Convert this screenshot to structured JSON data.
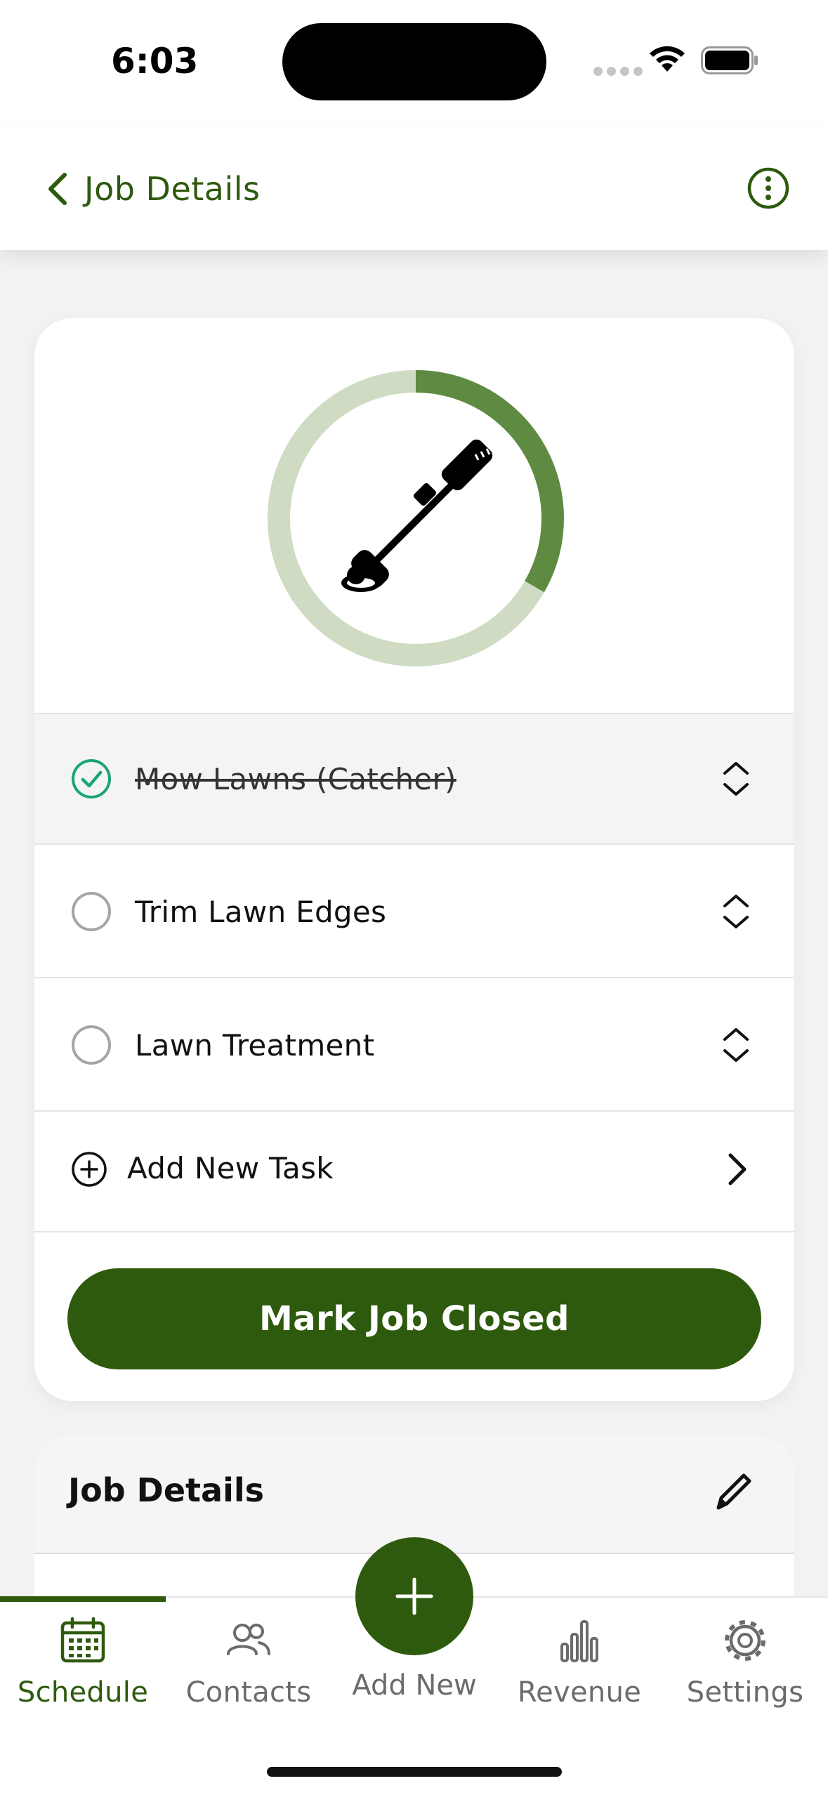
{
  "status_bar": {
    "time": "6:03"
  },
  "header": {
    "title": "Job Details",
    "back_icon": "chevron-left-icon",
    "menu_icon": "more-vertical-icon"
  },
  "job": {
    "progress_fraction": 0.333,
    "icon": "string-trimmer-icon",
    "tasks": [
      {
        "label": "Mow Lawns (Catcher)",
        "done": true
      },
      {
        "label": "Trim Lawn Edges",
        "done": false
      },
      {
        "label": "Lawn Treatment",
        "done": false
      }
    ],
    "add_task_label": "Add New Task",
    "close_button_label": "Mark Job Closed"
  },
  "details": {
    "title": "Job Details",
    "edit_icon": "pencil-icon"
  },
  "tabs": [
    {
      "label": "Schedule",
      "icon": "calendar-icon",
      "active": true
    },
    {
      "label": "Contacts",
      "icon": "users-icon",
      "active": false
    },
    {
      "label": "Add New",
      "icon": "plus-icon",
      "active": false
    },
    {
      "label": "Revenue",
      "icon": "bar-chart-icon",
      "active": false
    },
    {
      "label": "Settings",
      "icon": "gear-icon",
      "active": false
    }
  ],
  "colors": {
    "brand": "#2e5a0d",
    "progress_fill": "#5f8a41",
    "progress_track": "#cfdcc3",
    "check_done": "#1aa37a"
  }
}
